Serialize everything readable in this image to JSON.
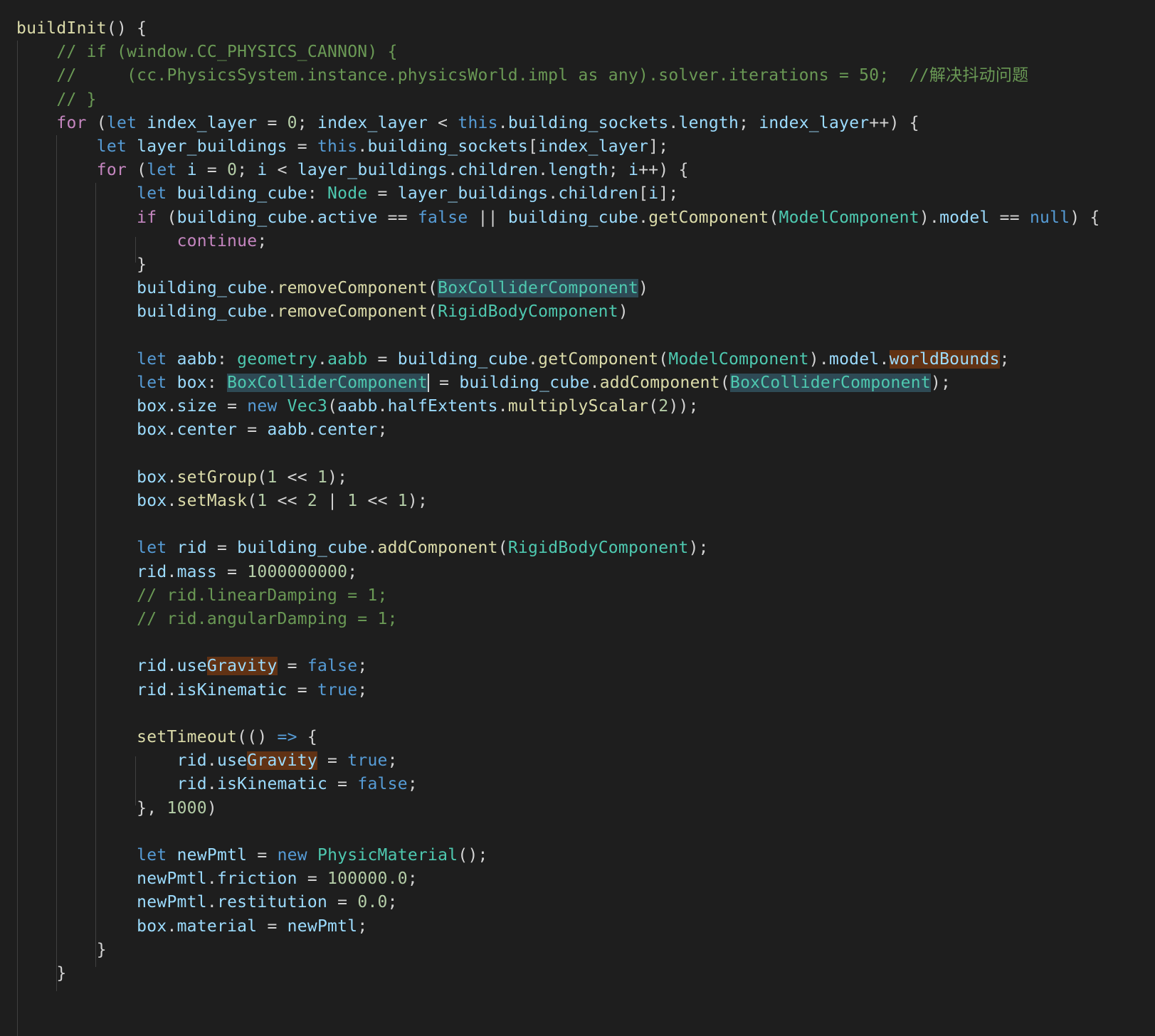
{
  "editor": {
    "palette": {
      "function": "#dcdcaa",
      "punctuation": "#d4d4d4",
      "comment": "#6a9955",
      "control_keyword": "#c586c0",
      "storage_keyword": "#569cd6",
      "variable": "#9cdcfe",
      "type": "#4ec9b0",
      "number": "#b5cea8",
      "background": "#1e1e1e",
      "selection_highlight": "#2e4a55",
      "find_highlight": "#613214"
    },
    "lines": [
      [
        [
          "f",
          "buildInit"
        ],
        [
          "p",
          "() {"
        ]
      ],
      [
        [
          "p",
          "    "
        ],
        [
          "c",
          "// if (window.CC_PHYSICS_CANNON) {"
        ]
      ],
      [
        [
          "p",
          "    "
        ],
        [
          "c",
          "//     (cc.PhysicsSystem.instance.physicsWorld.impl as any).solver.iterations = 50;  //解决抖动问题"
        ]
      ],
      [
        [
          "p",
          "    "
        ],
        [
          "c",
          "// }"
        ]
      ],
      [
        [
          "p",
          "    "
        ],
        [
          "k",
          "for"
        ],
        [
          "p",
          " ("
        ],
        [
          "s",
          "let"
        ],
        [
          "p",
          " "
        ],
        [
          "v",
          "index_layer"
        ],
        [
          "p",
          " = "
        ],
        [
          "n",
          "0"
        ],
        [
          "p",
          "; "
        ],
        [
          "v",
          "index_layer"
        ],
        [
          "p",
          " < "
        ],
        [
          "s",
          "this"
        ],
        [
          "p",
          "."
        ],
        [
          "v",
          "building_sockets"
        ],
        [
          "p",
          "."
        ],
        [
          "v",
          "length"
        ],
        [
          "p",
          "; "
        ],
        [
          "v",
          "index_layer"
        ],
        [
          "p",
          "++) {"
        ]
      ],
      [
        [
          "p",
          "        "
        ],
        [
          "s",
          "let"
        ],
        [
          "p",
          " "
        ],
        [
          "v",
          "layer_buildings"
        ],
        [
          "p",
          " = "
        ],
        [
          "s",
          "this"
        ],
        [
          "p",
          "."
        ],
        [
          "v",
          "building_sockets"
        ],
        [
          "p",
          "["
        ],
        [
          "v",
          "index_layer"
        ],
        [
          "p",
          "];"
        ]
      ],
      [
        [
          "p",
          "        "
        ],
        [
          "k",
          "for"
        ],
        [
          "p",
          " ("
        ],
        [
          "s",
          "let"
        ],
        [
          "p",
          " "
        ],
        [
          "v",
          "i"
        ],
        [
          "p",
          " = "
        ],
        [
          "n",
          "0"
        ],
        [
          "p",
          "; "
        ],
        [
          "v",
          "i"
        ],
        [
          "p",
          " < "
        ],
        [
          "v",
          "layer_buildings"
        ],
        [
          "p",
          "."
        ],
        [
          "v",
          "children"
        ],
        [
          "p",
          "."
        ],
        [
          "v",
          "length"
        ],
        [
          "p",
          "; "
        ],
        [
          "v",
          "i"
        ],
        [
          "p",
          "++) {"
        ]
      ],
      [
        [
          "p",
          "            "
        ],
        [
          "s",
          "let"
        ],
        [
          "p",
          " "
        ],
        [
          "v",
          "building_cube"
        ],
        [
          "p",
          ": "
        ],
        [
          "t",
          "Node"
        ],
        [
          "p",
          " = "
        ],
        [
          "v",
          "layer_buildings"
        ],
        [
          "p",
          "."
        ],
        [
          "v",
          "children"
        ],
        [
          "p",
          "["
        ],
        [
          "v",
          "i"
        ],
        [
          "p",
          "];"
        ]
      ],
      [
        [
          "p",
          "            "
        ],
        [
          "k",
          "if"
        ],
        [
          "p",
          " ("
        ],
        [
          "v",
          "building_cube"
        ],
        [
          "p",
          "."
        ],
        [
          "v",
          "active"
        ],
        [
          "p",
          " == "
        ],
        [
          "s",
          "false"
        ],
        [
          "p",
          " || "
        ],
        [
          "v",
          "building_cube"
        ],
        [
          "p",
          "."
        ],
        [
          "f",
          "getComponent"
        ],
        [
          "p",
          "("
        ],
        [
          "t",
          "ModelComponent"
        ],
        [
          "p",
          ")."
        ],
        [
          "v",
          "model"
        ],
        [
          "p",
          " == "
        ],
        [
          "s",
          "null"
        ],
        [
          "p",
          ") {"
        ]
      ],
      [
        [
          "p",
          "                "
        ],
        [
          "k",
          "continue"
        ],
        [
          "p",
          ";"
        ]
      ],
      [
        [
          "p",
          "            }"
        ]
      ],
      [
        [
          "p",
          "            "
        ],
        [
          "v",
          "building_cube"
        ],
        [
          "p",
          "."
        ],
        [
          "f",
          "removeComponent"
        ],
        [
          "p",
          "("
        ],
        [
          "t",
          "BoxColliderComponent",
          "sel"
        ],
        [
          "p",
          ")"
        ]
      ],
      [
        [
          "p",
          "            "
        ],
        [
          "v",
          "building_cube"
        ],
        [
          "p",
          "."
        ],
        [
          "f",
          "removeComponent"
        ],
        [
          "p",
          "("
        ],
        [
          "t",
          "RigidBodyComponent"
        ],
        [
          "p",
          ")"
        ]
      ],
      [],
      [
        [
          "p",
          "            "
        ],
        [
          "s",
          "let"
        ],
        [
          "p",
          " "
        ],
        [
          "v",
          "aabb"
        ],
        [
          "p",
          ": "
        ],
        [
          "t",
          "geometry"
        ],
        [
          "p",
          "."
        ],
        [
          "t",
          "aabb"
        ],
        [
          "p",
          " = "
        ],
        [
          "v",
          "building_cube"
        ],
        [
          "p",
          "."
        ],
        [
          "f",
          "getComponent"
        ],
        [
          "p",
          "("
        ],
        [
          "t",
          "ModelComponent"
        ],
        [
          "p",
          ")."
        ],
        [
          "v",
          "model"
        ],
        [
          "p",
          "."
        ],
        [
          "v",
          "worldBounds",
          "find"
        ],
        [
          "p",
          ";"
        ]
      ],
      [
        [
          "p",
          "            "
        ],
        [
          "s",
          "let"
        ],
        [
          "p",
          " "
        ],
        [
          "v",
          "box"
        ],
        [
          "p",
          ": "
        ],
        [
          "t",
          "BoxColliderComponent",
          "selcur"
        ],
        [
          "p",
          " = "
        ],
        [
          "v",
          "building_cube"
        ],
        [
          "p",
          "."
        ],
        [
          "f",
          "addComponent"
        ],
        [
          "p",
          "("
        ],
        [
          "t",
          "BoxColliderComponent",
          "sel"
        ],
        [
          "p",
          ");"
        ]
      ],
      [
        [
          "p",
          "            "
        ],
        [
          "v",
          "box"
        ],
        [
          "p",
          "."
        ],
        [
          "v",
          "size"
        ],
        [
          "p",
          " = "
        ],
        [
          "s",
          "new"
        ],
        [
          "p",
          " "
        ],
        [
          "t",
          "Vec3"
        ],
        [
          "p",
          "("
        ],
        [
          "v",
          "aabb"
        ],
        [
          "p",
          "."
        ],
        [
          "v",
          "halfExtents"
        ],
        [
          "p",
          "."
        ],
        [
          "f",
          "multiplyScalar"
        ],
        [
          "p",
          "("
        ],
        [
          "n",
          "2"
        ],
        [
          "p",
          "));"
        ]
      ],
      [
        [
          "p",
          "            "
        ],
        [
          "v",
          "box"
        ],
        [
          "p",
          "."
        ],
        [
          "v",
          "center"
        ],
        [
          "p",
          " = "
        ],
        [
          "v",
          "aabb"
        ],
        [
          "p",
          "."
        ],
        [
          "v",
          "center"
        ],
        [
          "p",
          ";"
        ]
      ],
      [],
      [
        [
          "p",
          "            "
        ],
        [
          "v",
          "box"
        ],
        [
          "p",
          "."
        ],
        [
          "f",
          "setGroup"
        ],
        [
          "p",
          "("
        ],
        [
          "n",
          "1"
        ],
        [
          "p",
          " << "
        ],
        [
          "n",
          "1"
        ],
        [
          "p",
          ");"
        ]
      ],
      [
        [
          "p",
          "            "
        ],
        [
          "v",
          "box"
        ],
        [
          "p",
          "."
        ],
        [
          "f",
          "setMask"
        ],
        [
          "p",
          "("
        ],
        [
          "n",
          "1"
        ],
        [
          "p",
          " << "
        ],
        [
          "n",
          "2"
        ],
        [
          "p",
          " | "
        ],
        [
          "n",
          "1"
        ],
        [
          "p",
          " << "
        ],
        [
          "n",
          "1"
        ],
        [
          "p",
          ");"
        ]
      ],
      [],
      [
        [
          "p",
          "            "
        ],
        [
          "s",
          "let"
        ],
        [
          "p",
          " "
        ],
        [
          "v",
          "rid"
        ],
        [
          "p",
          " = "
        ],
        [
          "v",
          "building_cube"
        ],
        [
          "p",
          "."
        ],
        [
          "f",
          "addComponent"
        ],
        [
          "p",
          "("
        ],
        [
          "t",
          "RigidBodyComponent"
        ],
        [
          "p",
          ");"
        ]
      ],
      [
        [
          "p",
          "            "
        ],
        [
          "v",
          "rid"
        ],
        [
          "p",
          "."
        ],
        [
          "v",
          "mass"
        ],
        [
          "p",
          " = "
        ],
        [
          "n",
          "1000000000"
        ],
        [
          "p",
          ";"
        ]
      ],
      [
        [
          "p",
          "            "
        ],
        [
          "c",
          "// rid.linearDamping = 1;"
        ]
      ],
      [
        [
          "p",
          "            "
        ],
        [
          "c",
          "// rid.angularDamping = 1;"
        ]
      ],
      [],
      [
        [
          "p",
          "            "
        ],
        [
          "v",
          "rid"
        ],
        [
          "p",
          "."
        ],
        [
          "v",
          "use"
        ],
        [
          "v",
          "Gravity",
          "find"
        ],
        [
          "p",
          " = "
        ],
        [
          "s",
          "false"
        ],
        [
          "p",
          ";"
        ]
      ],
      [
        [
          "p",
          "            "
        ],
        [
          "v",
          "rid"
        ],
        [
          "p",
          "."
        ],
        [
          "v",
          "isKinematic"
        ],
        [
          "p",
          " = "
        ],
        [
          "s",
          "true"
        ],
        [
          "p",
          ";"
        ]
      ],
      [],
      [
        [
          "p",
          "            "
        ],
        [
          "f",
          "setTimeout"
        ],
        [
          "p",
          "(() "
        ],
        [
          "s",
          "=>"
        ],
        [
          "p",
          " {"
        ]
      ],
      [
        [
          "p",
          "                "
        ],
        [
          "v",
          "rid"
        ],
        [
          "p",
          "."
        ],
        [
          "v",
          "use"
        ],
        [
          "v",
          "Gravity",
          "find"
        ],
        [
          "p",
          " = "
        ],
        [
          "s",
          "true"
        ],
        [
          "p",
          ";"
        ]
      ],
      [
        [
          "p",
          "                "
        ],
        [
          "v",
          "rid"
        ],
        [
          "p",
          "."
        ],
        [
          "v",
          "isKinematic"
        ],
        [
          "p",
          " = "
        ],
        [
          "s",
          "false"
        ],
        [
          "p",
          ";"
        ]
      ],
      [
        [
          "p",
          "            }, "
        ],
        [
          "n",
          "1000"
        ],
        [
          "p",
          ")"
        ]
      ],
      [],
      [
        [
          "p",
          "            "
        ],
        [
          "s",
          "let"
        ],
        [
          "p",
          " "
        ],
        [
          "v",
          "newPmtl"
        ],
        [
          "p",
          " = "
        ],
        [
          "s",
          "new"
        ],
        [
          "p",
          " "
        ],
        [
          "t",
          "PhysicMaterial"
        ],
        [
          "p",
          "();"
        ]
      ],
      [
        [
          "p",
          "            "
        ],
        [
          "v",
          "newPmtl"
        ],
        [
          "p",
          "."
        ],
        [
          "v",
          "friction"
        ],
        [
          "p",
          " = "
        ],
        [
          "n",
          "100000.0"
        ],
        [
          "p",
          ";"
        ]
      ],
      [
        [
          "p",
          "            "
        ],
        [
          "v",
          "newPmtl"
        ],
        [
          "p",
          "."
        ],
        [
          "v",
          "restitution"
        ],
        [
          "p",
          " = "
        ],
        [
          "n",
          "0.0"
        ],
        [
          "p",
          ";"
        ]
      ],
      [
        [
          "p",
          "            "
        ],
        [
          "v",
          "box"
        ],
        [
          "p",
          "."
        ],
        [
          "v",
          "material"
        ],
        [
          "p",
          " = "
        ],
        [
          "v",
          "newPmtl"
        ],
        [
          "p",
          ";"
        ]
      ],
      [
        [
          "p",
          "        }"
        ]
      ],
      [
        [
          "p",
          "    }"
        ]
      ],
      []
    ]
  }
}
